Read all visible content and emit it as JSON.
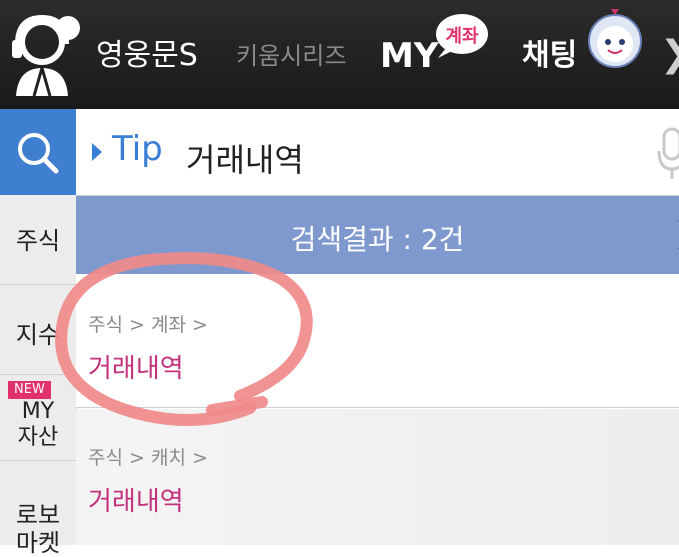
{
  "top_tabs": {
    "tab1": "영웅문S",
    "tab2": "키움시리즈",
    "tab3": "MY",
    "tab3_badge": "계좌",
    "tab4": "채팅",
    "more_icon": "chevron-right-icon"
  },
  "search": {
    "tip_label": "Tip",
    "query": "거래내역",
    "search_icon": "search-icon",
    "mic_icon": "microphone-icon"
  },
  "sidebar": {
    "items": [
      {
        "label": "주식"
      },
      {
        "label": "지수"
      },
      {
        "badge": "NEW",
        "label": "MY\n자산"
      },
      {
        "label": "로보\n마켓"
      }
    ]
  },
  "result": {
    "summary": "검색결과 : 2건"
  },
  "results": [
    {
      "path": "주식 > 계좌 >",
      "name": "거래내역"
    },
    {
      "path": "주식 > 캐치 >",
      "name": "거래내역"
    }
  ],
  "colors": {
    "topbar": "#1f1f1f",
    "search_button": "#3f7fd0",
    "result_bar": "#7f99cf",
    "menu_name": "#c2327d",
    "annotation_circle": "#f08a8a"
  }
}
